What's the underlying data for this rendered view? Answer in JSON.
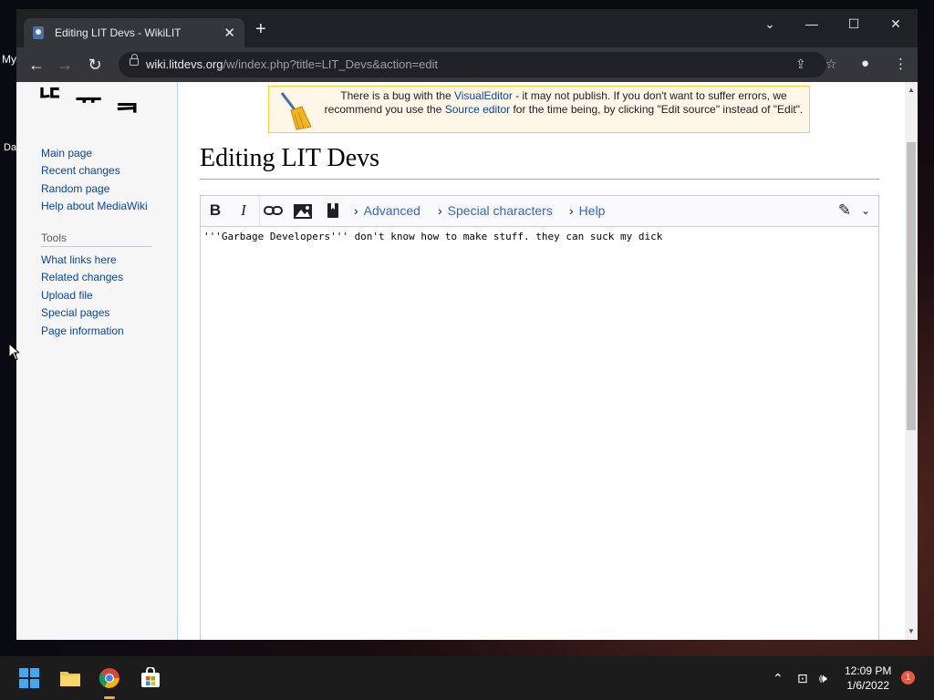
{
  "desktop": {
    "label_top": "My",
    "label_mid": "Da"
  },
  "browser": {
    "tab_title": "Editing LIT Devs - WikiLIT",
    "url_host": "wiki.litdevs.org",
    "url_path": "/w/index.php?title=LIT_Devs&action=edit"
  },
  "sidebar": {
    "nav_items": [
      "Main page",
      "Recent changes",
      "Random page",
      "Help about MediaWiki"
    ],
    "tools_heading": "Tools",
    "tools_items": [
      "What links here",
      "Related changes",
      "Upload file",
      "Special pages",
      "Page information"
    ]
  },
  "notice": {
    "part1": "There is a bug with the ",
    "link1": "VisualEditor",
    "part2": " - it may not publish. If you don't want to suffer errors, we recommend you use the ",
    "link2": "Source editor",
    "part3": " for the time being, by clicking \"Edit source\" instead of \"Edit\"."
  },
  "page": {
    "title": "Editing LIT Devs"
  },
  "editor": {
    "bold": "B",
    "italic": "I",
    "advanced": "Advanced",
    "special_characters": "Special characters",
    "help": "Help",
    "content": "'''Garbage Developers''' don't know how to make stuff. they can suck my dick"
  },
  "taskbar": {
    "time": "12:09 PM",
    "date": "1/6/2022",
    "notifications": "1"
  },
  "colors": {
    "link": "#0645ad",
    "editor_link": "#3366cc",
    "notice_border": "#ffcc33",
    "titlebar": "#202124"
  }
}
